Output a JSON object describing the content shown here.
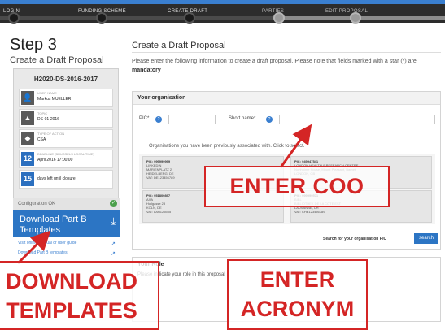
{
  "progress": {
    "steps": [
      {
        "label": "LOGIN",
        "state": "done"
      },
      {
        "label": "FUNDING SCHEME",
        "state": "done"
      },
      {
        "label": "CREATE DRAFT",
        "state": "done"
      },
      {
        "label": "PARTIES",
        "state": "todo"
      },
      {
        "label": "EDIT PROPOSAL",
        "state": "todo"
      }
    ]
  },
  "left": {
    "step_title": "Step 3",
    "step_subtitle": "Create a Draft Proposal",
    "call_id": "H2020-DS-2016-2017",
    "info": [
      {
        "icon": "user-icon",
        "glyph": "👤",
        "label": "USER NAME",
        "value": "Markus MUELLER"
      },
      {
        "icon": "topic-icon",
        "glyph": "▲",
        "label": "TOPIC",
        "value": "DS-01-2016"
      },
      {
        "icon": "action-icon",
        "glyph": "◆",
        "label": "TYPE OF ACTION",
        "value": "CSA"
      },
      {
        "icon": "calendar-icon",
        "glyph": "12",
        "label": "DEADLINE (Brussels Local Time)",
        "value": "April 2016 17:00:00"
      },
      {
        "icon": "days-icon",
        "glyph": "15",
        "label": "",
        "value": "days left until closure"
      }
    ],
    "config_label": "Configuration OK",
    "download_label": "Download Part B Templates",
    "links": [
      "Visit online manual or user guide",
      "Download Part B templates"
    ]
  },
  "main": {
    "title": "Create a Draft Proposal",
    "desc_prefix": "Please enter the following information to create a draft proposal. Please note that fields marked with a star (*) are ",
    "desc_bold": "mandatory",
    "org_section_title": "Your organisation",
    "pic_label": "PIC*",
    "short_name_label": "Short name*",
    "assoc_text": "Organisations you have been previously associated with. Click to select.",
    "orgs": [
      [
        "PIC: 999999999",
        "LINKEDIN",
        "MARIENPLATZ 2",
        "HEIDELBERG, DE",
        "VAT: DE123456789"
      ],
      [
        "PIC: 949947541",
        "LONDON HEALTH & RESEARCH CENTRE",
        "Northolme House, Mount Pleasant, Barnet",
        "LONDON, GB",
        ""
      ],
      [
        "PIC: 951800897",
        "AXA",
        "Hollgasse 23",
        "KOLN, DE",
        "VAT: LAN125555"
      ],
      [
        "PIC: 999999571",
        "BIBL",
        "BIBLIOTHEK DE LA COTE EST",
        "LAUSANNE, CH",
        "VAT: CHE123456789"
      ]
    ],
    "search_label": "Search for your organisation PIC",
    "search_button": "search",
    "role_title": "Your Role",
    "role_text": "Please indicate your role in this proposal"
  },
  "annotations": {
    "enter_coo": "ENTER COO",
    "download_line1": "DOWNLOAD",
    "download_line2": "TEMPLATES",
    "acronym_line1": "ENTER",
    "acronym_line2": "ACRONYM",
    "color": "#d42525"
  }
}
